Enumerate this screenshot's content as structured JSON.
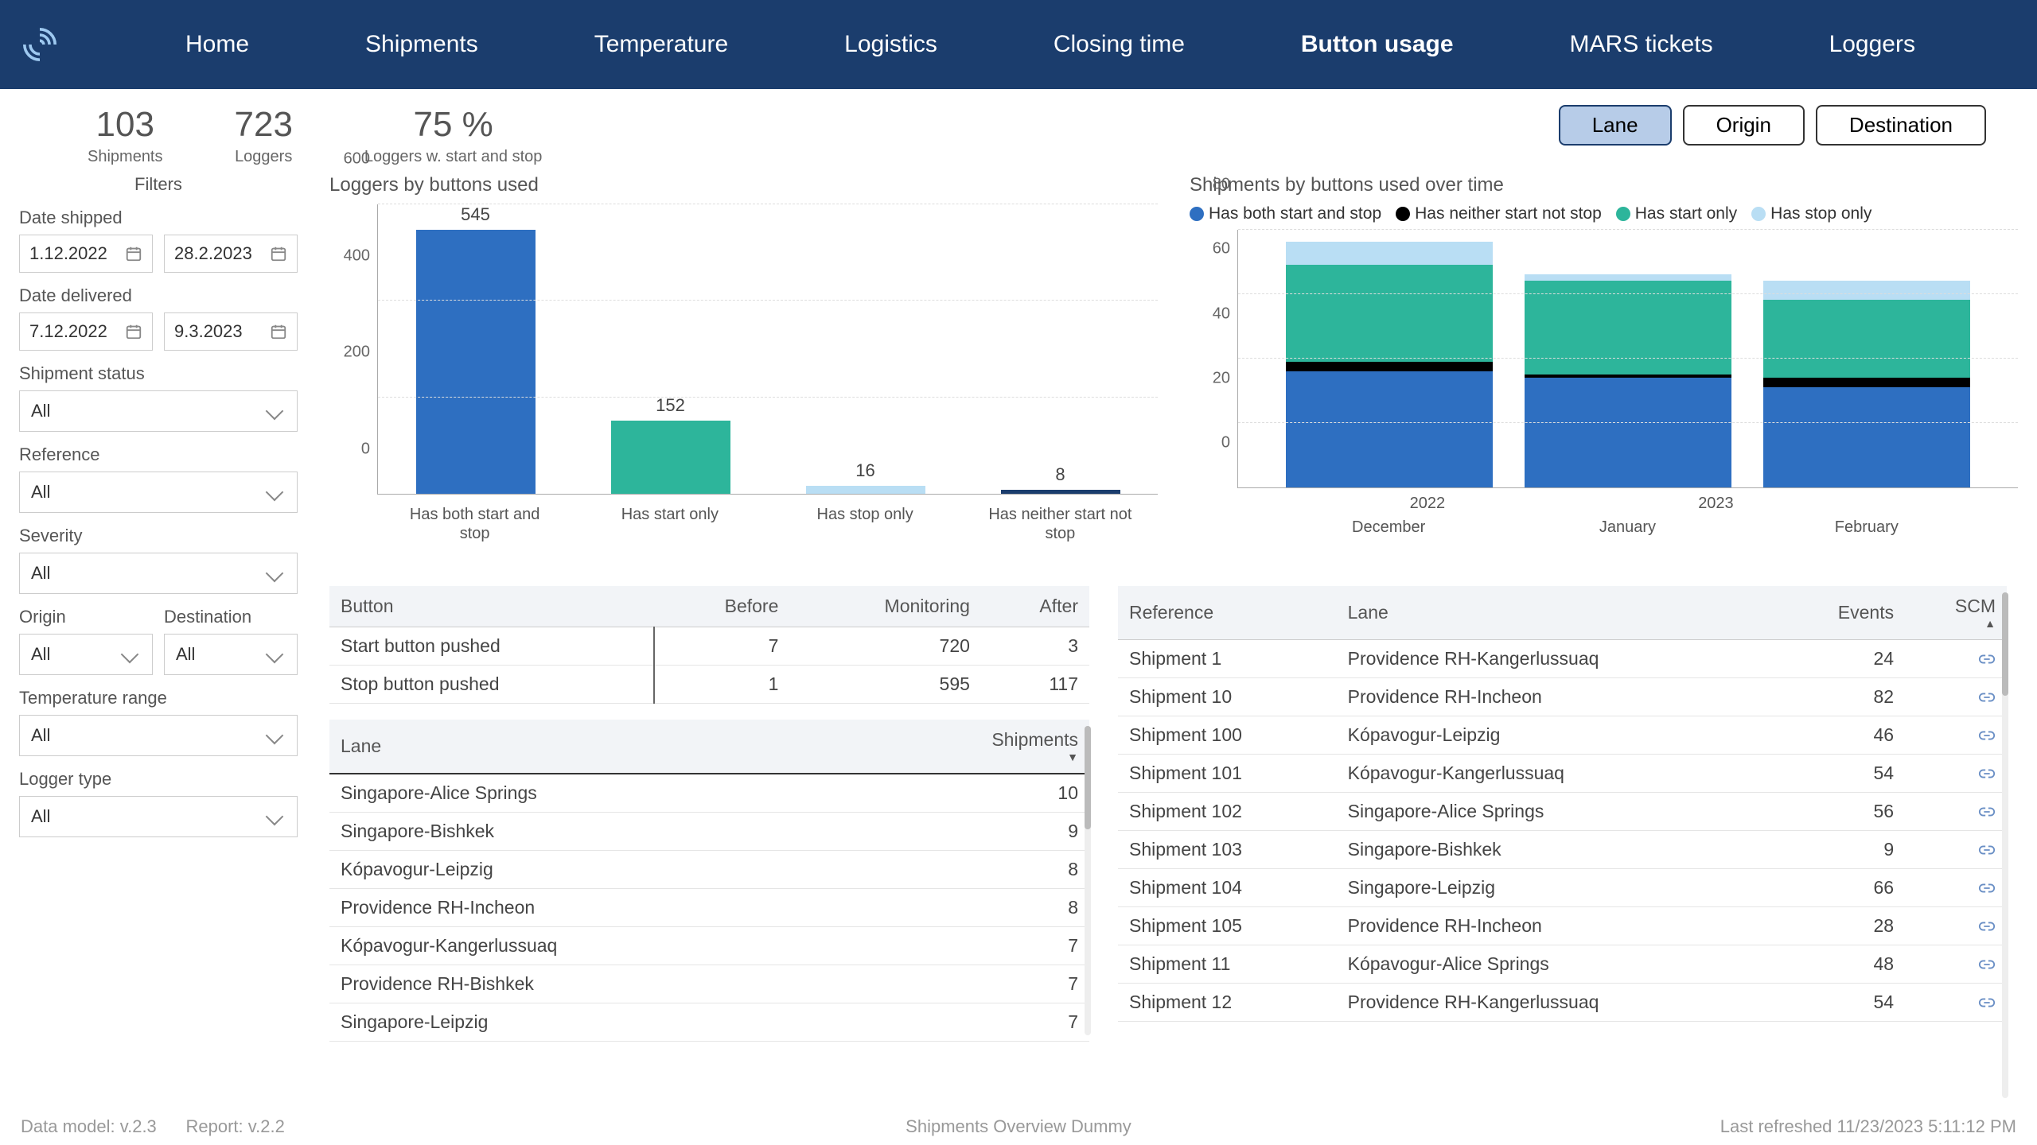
{
  "nav": {
    "items": [
      "Home",
      "Shipments",
      "Temperature",
      "Logistics",
      "Closing time",
      "Button usage",
      "MARS tickets",
      "Loggers"
    ],
    "active": "Button usage"
  },
  "kpis": [
    {
      "value": "103",
      "label": "Shipments"
    },
    {
      "value": "723",
      "label": "Loggers"
    },
    {
      "value": "75 %",
      "label": "Loggers w. start and stop"
    }
  ],
  "toggles": {
    "lane": "Lane",
    "origin": "Origin",
    "dest": "Destination",
    "selected": "lane"
  },
  "filters": {
    "title": "Filters",
    "date_shipped_lbl": "Date shipped",
    "date_shipped_from": "1.12.2022",
    "date_shipped_to": "28.2.2023",
    "date_delivered_lbl": "Date delivered",
    "date_delivered_from": "7.12.2022",
    "date_delivered_to": "9.3.2023",
    "shipment_status_lbl": "Shipment status",
    "shipment_status_val": "All",
    "reference_lbl": "Reference",
    "reference_val": "All",
    "severity_lbl": "Severity",
    "severity_val": "All",
    "origin_lbl": "Origin",
    "origin_val": "All",
    "destination_lbl": "Destination",
    "destination_val": "All",
    "temp_range_lbl": "Temperature range",
    "temp_range_val": "All",
    "logger_type_lbl": "Logger type",
    "logger_type_val": "All"
  },
  "colors": {
    "both": "#2e6fc1",
    "startonly": "#2db59b",
    "stoponly": "#b9def4",
    "neither": "#000000"
  },
  "chart_data": [
    {
      "id": "loggers_by_buttons",
      "type": "bar",
      "title": "Loggers by buttons used",
      "categories": [
        "Has both start and stop",
        "Has start only",
        "Has stop only",
        "Has neither start not stop"
      ],
      "values": [
        545,
        152,
        16,
        8
      ],
      "colors": [
        "#2e6fc1",
        "#2db59b",
        "#b9def4",
        "#1b3d6d"
      ],
      "yticks": [
        0,
        200,
        400,
        600
      ],
      "ymax": 600
    },
    {
      "id": "shipments_over_time",
      "type": "stacked_bar",
      "title": "Shipments by buttons used over time",
      "legend": [
        "Has both start and stop",
        "Has neither start not stop",
        "Has start only",
        "Has stop only"
      ],
      "legend_colors": [
        "#2e6fc1",
        "#000000",
        "#2db59b",
        "#b9def4"
      ],
      "categories": [
        "December",
        "January",
        "February"
      ],
      "year_labels": [
        "2022",
        "2023"
      ],
      "series": [
        {
          "name": "Has both start and stop",
          "color": "#2e6fc1",
          "values": [
            36,
            34,
            31
          ]
        },
        {
          "name": "Has neither start not stop",
          "color": "#000000",
          "values": [
            3,
            1,
            3
          ]
        },
        {
          "name": "Has start only",
          "color": "#2db59b",
          "values": [
            30,
            29,
            24
          ]
        },
        {
          "name": "Has stop only",
          "color": "#b9def4",
          "values": [
            7,
            2,
            6
          ]
        }
      ],
      "yticks": [
        0,
        20,
        40,
        60,
        80
      ],
      "ymax": 80
    }
  ],
  "button_table": {
    "headers": [
      "Button",
      "Before",
      "Monitoring",
      "After"
    ],
    "rows": [
      {
        "button": "Start button pushed",
        "before": 7,
        "monitoring": 720,
        "after": 3
      },
      {
        "button": "Stop button pushed",
        "before": 1,
        "monitoring": 595,
        "after": 117
      }
    ]
  },
  "lane_table": {
    "headers": [
      "Lane",
      "Shipments"
    ],
    "rows": [
      {
        "lane": "Singapore-Alice Springs",
        "shipments": 10
      },
      {
        "lane": "Singapore-Bishkek",
        "shipments": 9
      },
      {
        "lane": "Kópavogur-Leipzig",
        "shipments": 8
      },
      {
        "lane": "Providence RH-Incheon",
        "shipments": 8
      },
      {
        "lane": "Kópavogur-Kangerlussuaq",
        "shipments": 7
      },
      {
        "lane": "Providence RH-Bishkek",
        "shipments": 7
      },
      {
        "lane": "Singapore-Leipzig",
        "shipments": 7
      }
    ]
  },
  "shipments_table": {
    "headers": [
      "Reference",
      "Lane",
      "Events",
      "SCM"
    ],
    "rows": [
      {
        "ref": "Shipment 1",
        "lane": "Providence RH-Kangerlussuaq",
        "events": 24
      },
      {
        "ref": "Shipment 10",
        "lane": "Providence RH-Incheon",
        "events": 82
      },
      {
        "ref": "Shipment 100",
        "lane": "Kópavogur-Leipzig",
        "events": 46
      },
      {
        "ref": "Shipment 101",
        "lane": "Kópavogur-Kangerlussuaq",
        "events": 54
      },
      {
        "ref": "Shipment 102",
        "lane": "Singapore-Alice Springs",
        "events": 56
      },
      {
        "ref": "Shipment 103",
        "lane": "Singapore-Bishkek",
        "events": 9
      },
      {
        "ref": "Shipment 104",
        "lane": "Singapore-Leipzig",
        "events": 66
      },
      {
        "ref": "Shipment 105",
        "lane": "Providence RH-Incheon",
        "events": 28
      },
      {
        "ref": "Shipment 11",
        "lane": "Kópavogur-Alice Springs",
        "events": 48
      },
      {
        "ref": "Shipment 12",
        "lane": "Providence RH-Kangerlussuaq",
        "events": 54
      }
    ]
  },
  "footer": {
    "data_model": "Data model: v.2.3",
    "report": "Report: v.2.2",
    "mid": "Shipments Overview Dummy",
    "refreshed": "Last refreshed 11/23/2023 5:11:12 PM"
  }
}
